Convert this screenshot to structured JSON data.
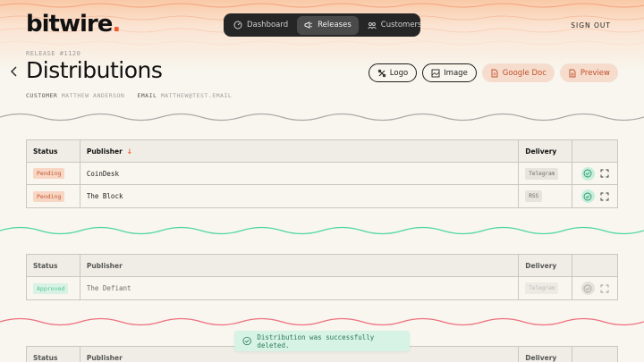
{
  "header": {
    "logo_text": "bitwire",
    "logo_dot": ".",
    "nav": [
      {
        "label": "Dashboard",
        "icon": "dashboard-icon",
        "active": false
      },
      {
        "label": "Releases",
        "icon": "megaphone-icon",
        "active": true
      },
      {
        "label": "Customers",
        "icon": "users-icon",
        "active": false
      }
    ],
    "sign_out": "SIGN OUT"
  },
  "page": {
    "release_label": "RELEASE #1120",
    "title": "Distributions",
    "customer_label": "CUSTOMER",
    "customer_value": "MATTHEW ANDERSON",
    "email_label": "EMAIL",
    "email_value": "MATTHEW@TEST.EMAIL"
  },
  "actions": {
    "logo": "Logo",
    "image": "Image",
    "google_doc": "Google Doc",
    "preview": "Preview"
  },
  "columns": {
    "status": "Status",
    "publisher": "Publisher",
    "delivery": "Delivery"
  },
  "pending_table": [
    {
      "status": "Pending",
      "publisher": "CoinDesk",
      "delivery": "Telegram"
    },
    {
      "status": "Pending",
      "publisher": "The Block",
      "delivery": "RSS"
    }
  ],
  "approved_table": [
    {
      "status": "Approved",
      "publisher": "The Defiant",
      "delivery": "Telegram"
    }
  ],
  "toast": {
    "message": "Distribution was successfully deleted."
  },
  "colors": {
    "accent": "#ef5a2a",
    "pending": "#c4562f",
    "approved": "#55c38f",
    "wave_gray": "#aaaaaa",
    "wave_green": "#4fd6a3",
    "wave_red": "#ef6f7e"
  }
}
